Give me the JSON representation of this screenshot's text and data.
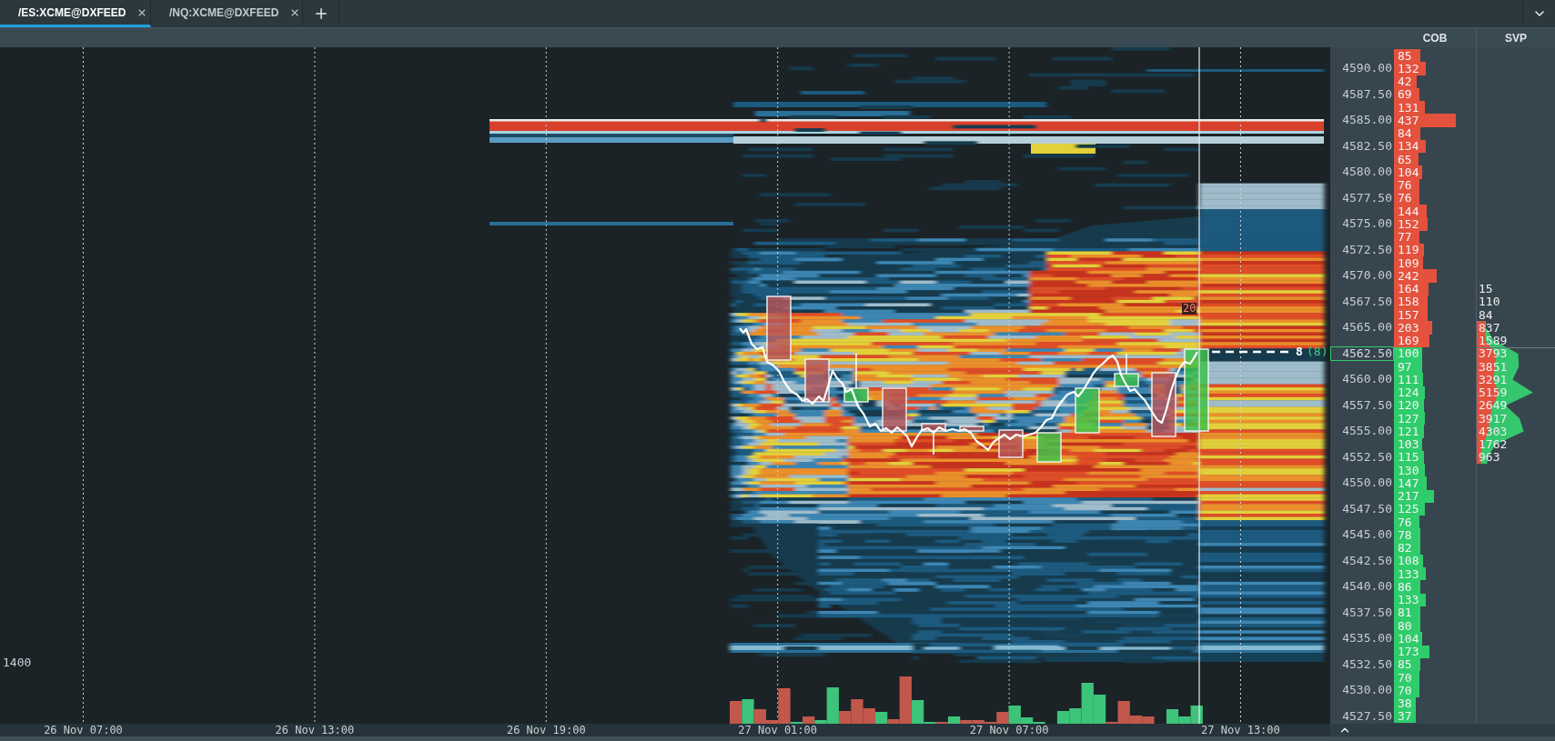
{
  "tabs": [
    {
      "label": "/ES:XCME@DXFEED",
      "selected": true
    },
    {
      "label": "/NQ:XCME@DXFEED",
      "selected": false
    }
  ],
  "column_headers": [
    "COB",
    "SVP"
  ],
  "chart": {
    "volume_scale_label": "1400",
    "marker_label": "20",
    "last_trade_label": {
      "text": "8",
      "secondary_text": "(8)"
    },
    "time_axis": [
      "26 Nov 07:00",
      "26 Nov 13:00",
      "26 Nov 19:00",
      "27 Nov 01:00",
      "27 Nov 07:00",
      "27 Nov 13:00"
    ]
  },
  "price_axis": [
    {
      "label": "4590.00",
      "current": false
    },
    {
      "label": "4587.50",
      "current": false
    },
    {
      "label": "4585.00",
      "current": false
    },
    {
      "label": "4582.50",
      "current": false
    },
    {
      "label": "4580.00",
      "current": false
    },
    {
      "label": "4577.50",
      "current": false
    },
    {
      "label": "4575.00",
      "current": false
    },
    {
      "label": "4572.50",
      "current": false
    },
    {
      "label": "4570.00",
      "current": false
    },
    {
      "label": "4567.50",
      "current": false
    },
    {
      "label": "4565.00",
      "current": false
    },
    {
      "label": "4562.50",
      "current": true
    },
    {
      "label": "4560.00",
      "current": false
    },
    {
      "label": "4557.50",
      "current": false
    },
    {
      "label": "4555.00",
      "current": false
    },
    {
      "label": "4552.50",
      "current": false
    },
    {
      "label": "4550.00",
      "current": false
    },
    {
      "label": "4547.50",
      "current": false
    },
    {
      "label": "4545.00",
      "current": false
    },
    {
      "label": "4542.50",
      "current": false
    },
    {
      "label": "4540.00",
      "current": false
    },
    {
      "label": "4537.50",
      "current": false
    },
    {
      "label": "4535.00",
      "current": false
    },
    {
      "label": "4532.50",
      "current": false
    },
    {
      "label": "4530.00",
      "current": false
    },
    {
      "label": "4527.50",
      "current": false
    }
  ],
  "ladder": [
    {
      "kind": "ask",
      "size": "85"
    },
    {
      "kind": "ask",
      "size": "132"
    },
    {
      "kind": "ask",
      "size": "42"
    },
    {
      "kind": "ask",
      "size": "69"
    },
    {
      "kind": "ask",
      "size": "131"
    },
    {
      "kind": "ask",
      "size": "437"
    },
    {
      "kind": "ask",
      "size": "84"
    },
    {
      "kind": "ask",
      "size": "134"
    },
    {
      "kind": "ask",
      "size": "65"
    },
    {
      "kind": "ask",
      "size": "104"
    },
    {
      "kind": "ask",
      "size": "76"
    },
    {
      "kind": "ask",
      "size": "76"
    },
    {
      "kind": "ask",
      "size": "144"
    },
    {
      "kind": "ask",
      "size": "152"
    },
    {
      "kind": "ask",
      "size": "77"
    },
    {
      "kind": "ask",
      "size": "119"
    },
    {
      "kind": "ask",
      "size": "109"
    },
    {
      "kind": "ask",
      "size": "242"
    },
    {
      "kind": "ask",
      "size": "164",
      "svp": "15"
    },
    {
      "kind": "ask",
      "size": "158",
      "svp": "110"
    },
    {
      "kind": "ask",
      "size": "157",
      "svp": "84"
    },
    {
      "kind": "ask",
      "size": "203",
      "svp": "837"
    },
    {
      "kind": "ask",
      "size": "169",
      "svp": "1589"
    },
    {
      "kind": "bid",
      "size": "100",
      "svp": "3793"
    },
    {
      "kind": "bid",
      "size": "97",
      "svp": "3851"
    },
    {
      "kind": "bid",
      "size": "111",
      "svp": "3291"
    },
    {
      "kind": "bid",
      "size": "124",
      "svp": "5159"
    },
    {
      "kind": "bid",
      "size": "120",
      "svp": "2649"
    },
    {
      "kind": "bid",
      "size": "127",
      "svp": "3917"
    },
    {
      "kind": "bid",
      "size": "121",
      "svp": "4303"
    },
    {
      "kind": "bid",
      "size": "103",
      "svp": "1762"
    },
    {
      "kind": "bid",
      "size": "115",
      "svp": "963"
    },
    {
      "kind": "bid",
      "size": "130"
    },
    {
      "kind": "bid",
      "size": "147"
    },
    {
      "kind": "bid",
      "size": "217"
    },
    {
      "kind": "bid",
      "size": "125"
    },
    {
      "kind": "bid",
      "size": "76"
    },
    {
      "kind": "bid",
      "size": "78"
    },
    {
      "kind": "bid",
      "size": "82"
    },
    {
      "kind": "bid",
      "size": "108"
    },
    {
      "kind": "bid",
      "size": "133"
    },
    {
      "kind": "bid",
      "size": "86"
    },
    {
      "kind": "bid",
      "size": "133"
    },
    {
      "kind": "bid",
      "size": "81"
    },
    {
      "kind": "bid",
      "size": "80"
    },
    {
      "kind": "bid",
      "size": "104"
    },
    {
      "kind": "bid",
      "size": "173"
    },
    {
      "kind": "bid",
      "size": "85"
    },
    {
      "kind": "bid",
      "size": "70"
    },
    {
      "kind": "bid",
      "size": "70"
    },
    {
      "kind": "bid",
      "size": "38"
    },
    {
      "kind": "bid",
      "size": "37"
    }
  ]
}
